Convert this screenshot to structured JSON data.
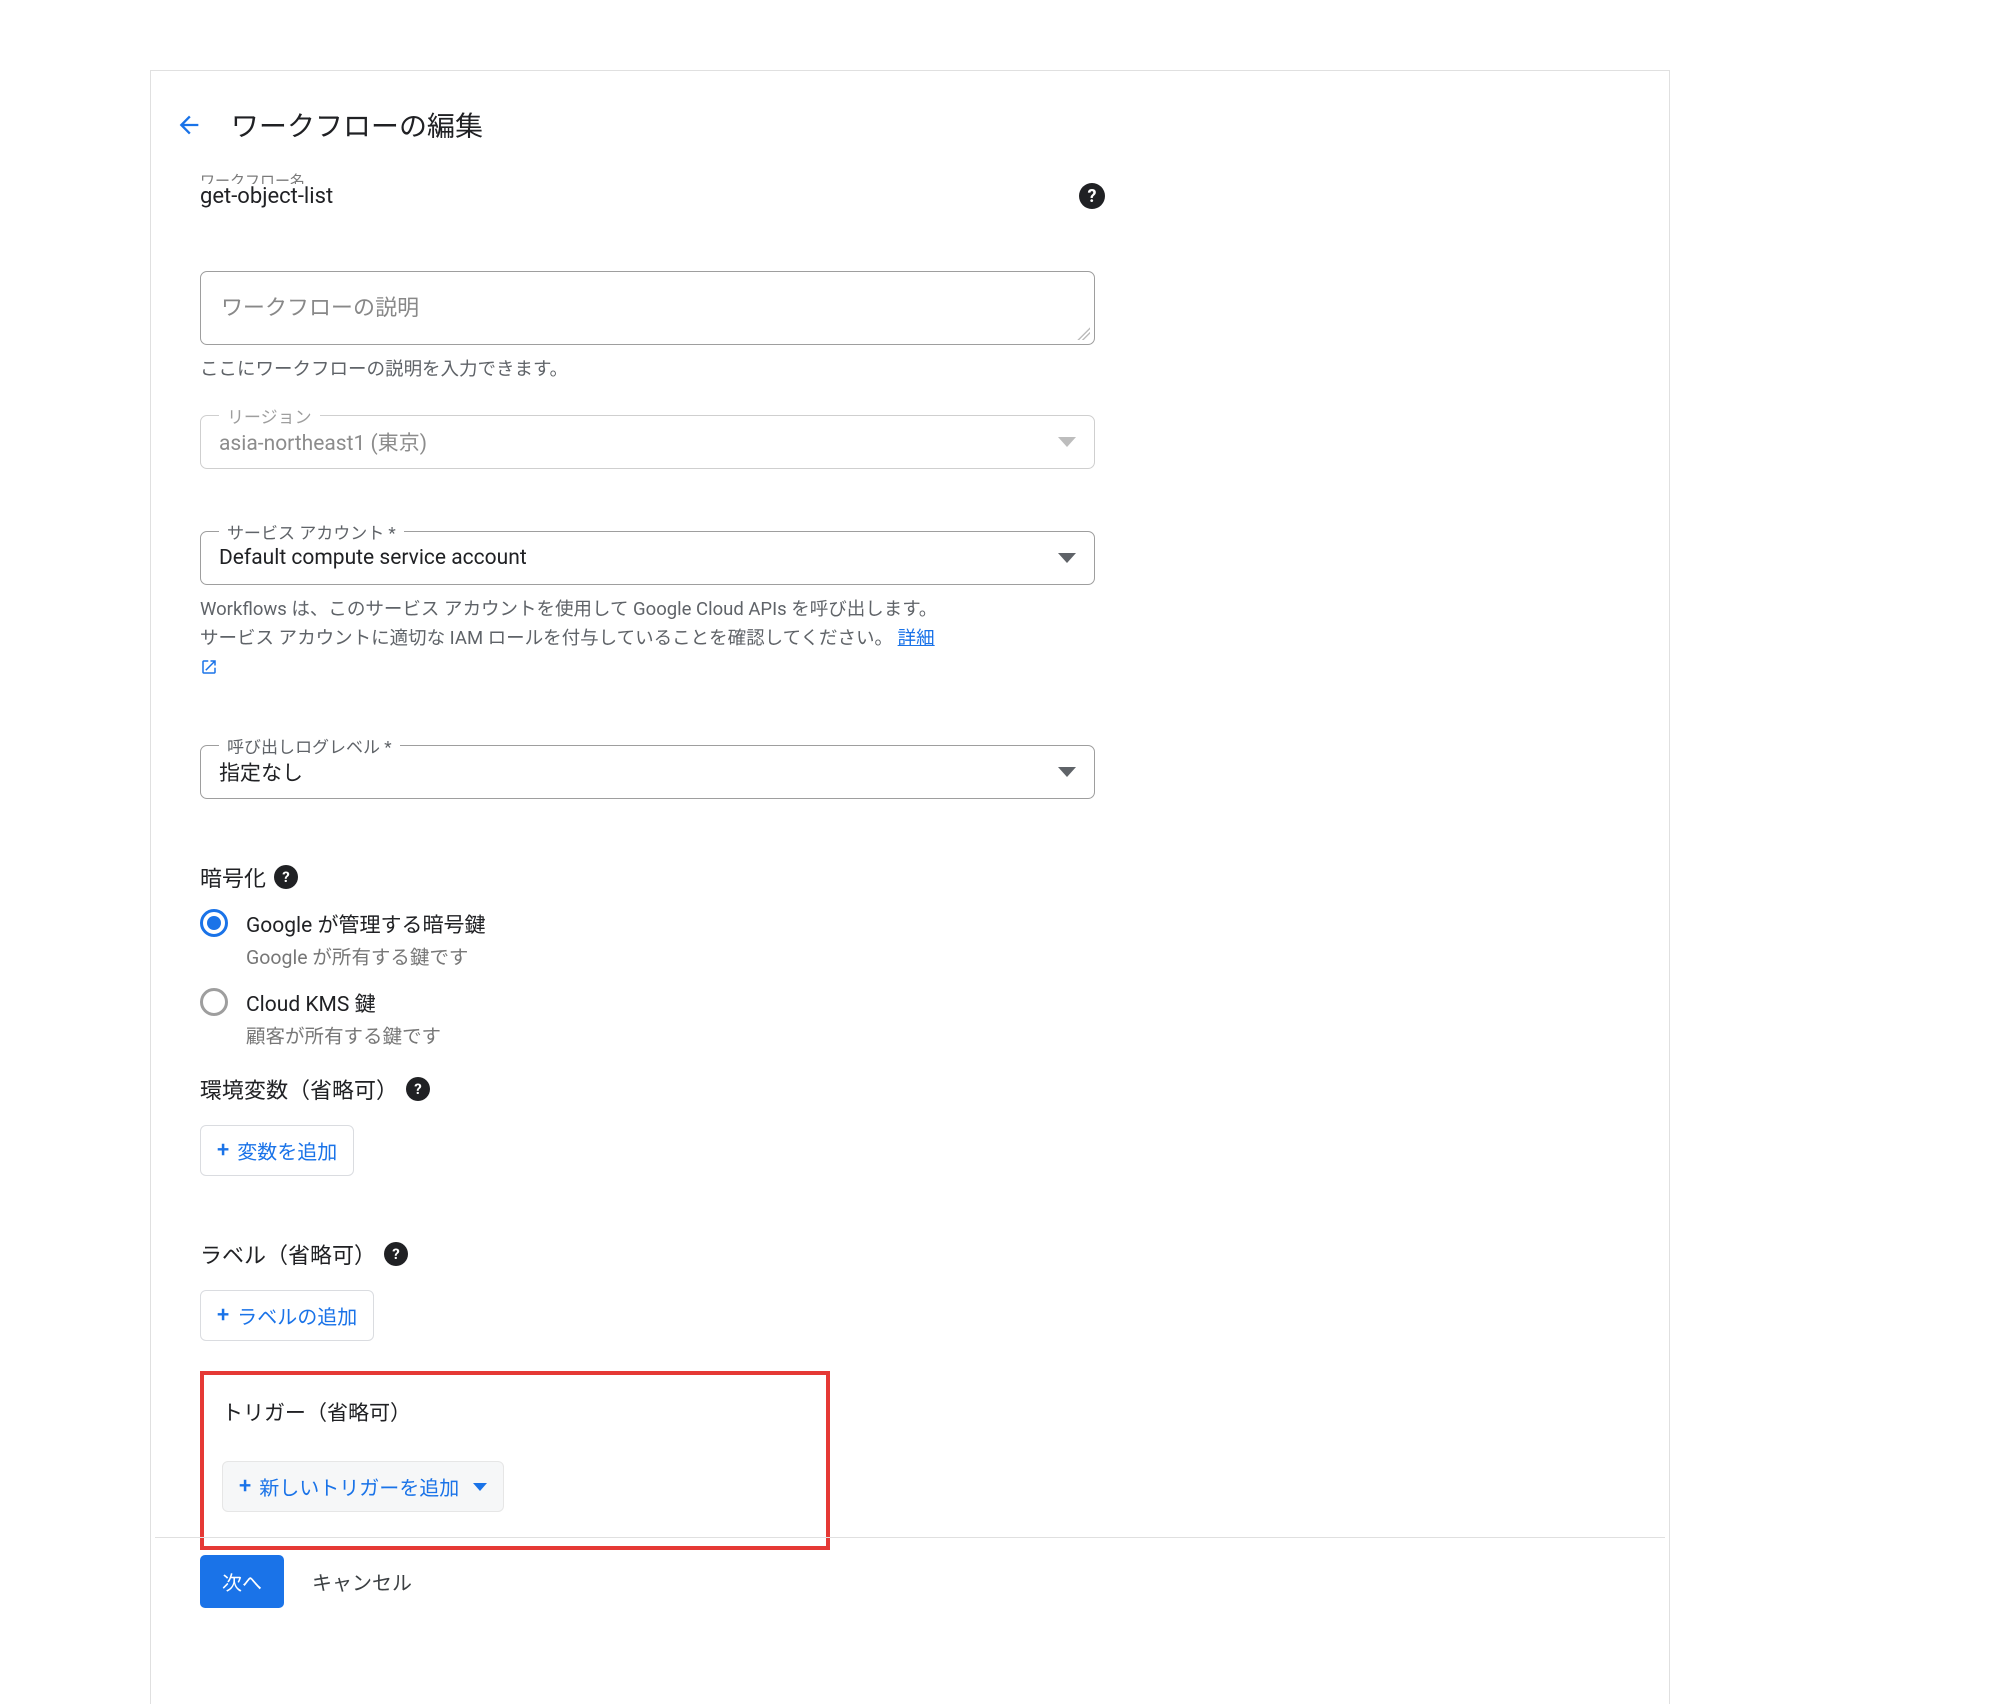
{
  "header": {
    "title": "ワークフローの編集"
  },
  "name": {
    "label_clipped": "ワークフロー名",
    "value": "get-object-list"
  },
  "description": {
    "placeholder": "ワークフローの説明",
    "helper": "ここにワークフローの説明を入力できます。"
  },
  "region": {
    "label": "リージョン",
    "value": "asia-northeast1 (東京)"
  },
  "serviceAccount": {
    "label": "サービス アカウント *",
    "value": "Default compute service account",
    "helper1": "Workflows は、このサービス アカウントを使用して Google Cloud APIs を呼び出します。",
    "helper2": "サービス アカウントに適切な IAM ロールを付与していることを確認してください。",
    "detailsLink": "詳細"
  },
  "logLevel": {
    "label": "呼び出しログレベル *",
    "value": "指定なし"
  },
  "encryption": {
    "title": "暗号化",
    "options": [
      {
        "label": "Google が管理する暗号鍵",
        "desc": "Google が所有する鍵です",
        "selected": true
      },
      {
        "label": "Cloud KMS 鍵",
        "desc": "顧客が所有する鍵です",
        "selected": false
      }
    ]
  },
  "envVars": {
    "title": "環境変数（省略可）",
    "addLabel": "変数を追加"
  },
  "labels": {
    "title": "ラベル（省略可）",
    "addLabel": "ラベルの追加"
  },
  "triggers": {
    "title": "トリガー（省略可）",
    "addLabel": "新しいトリガーを追加"
  },
  "footer": {
    "next": "次へ",
    "cancel": "キャンセル"
  }
}
